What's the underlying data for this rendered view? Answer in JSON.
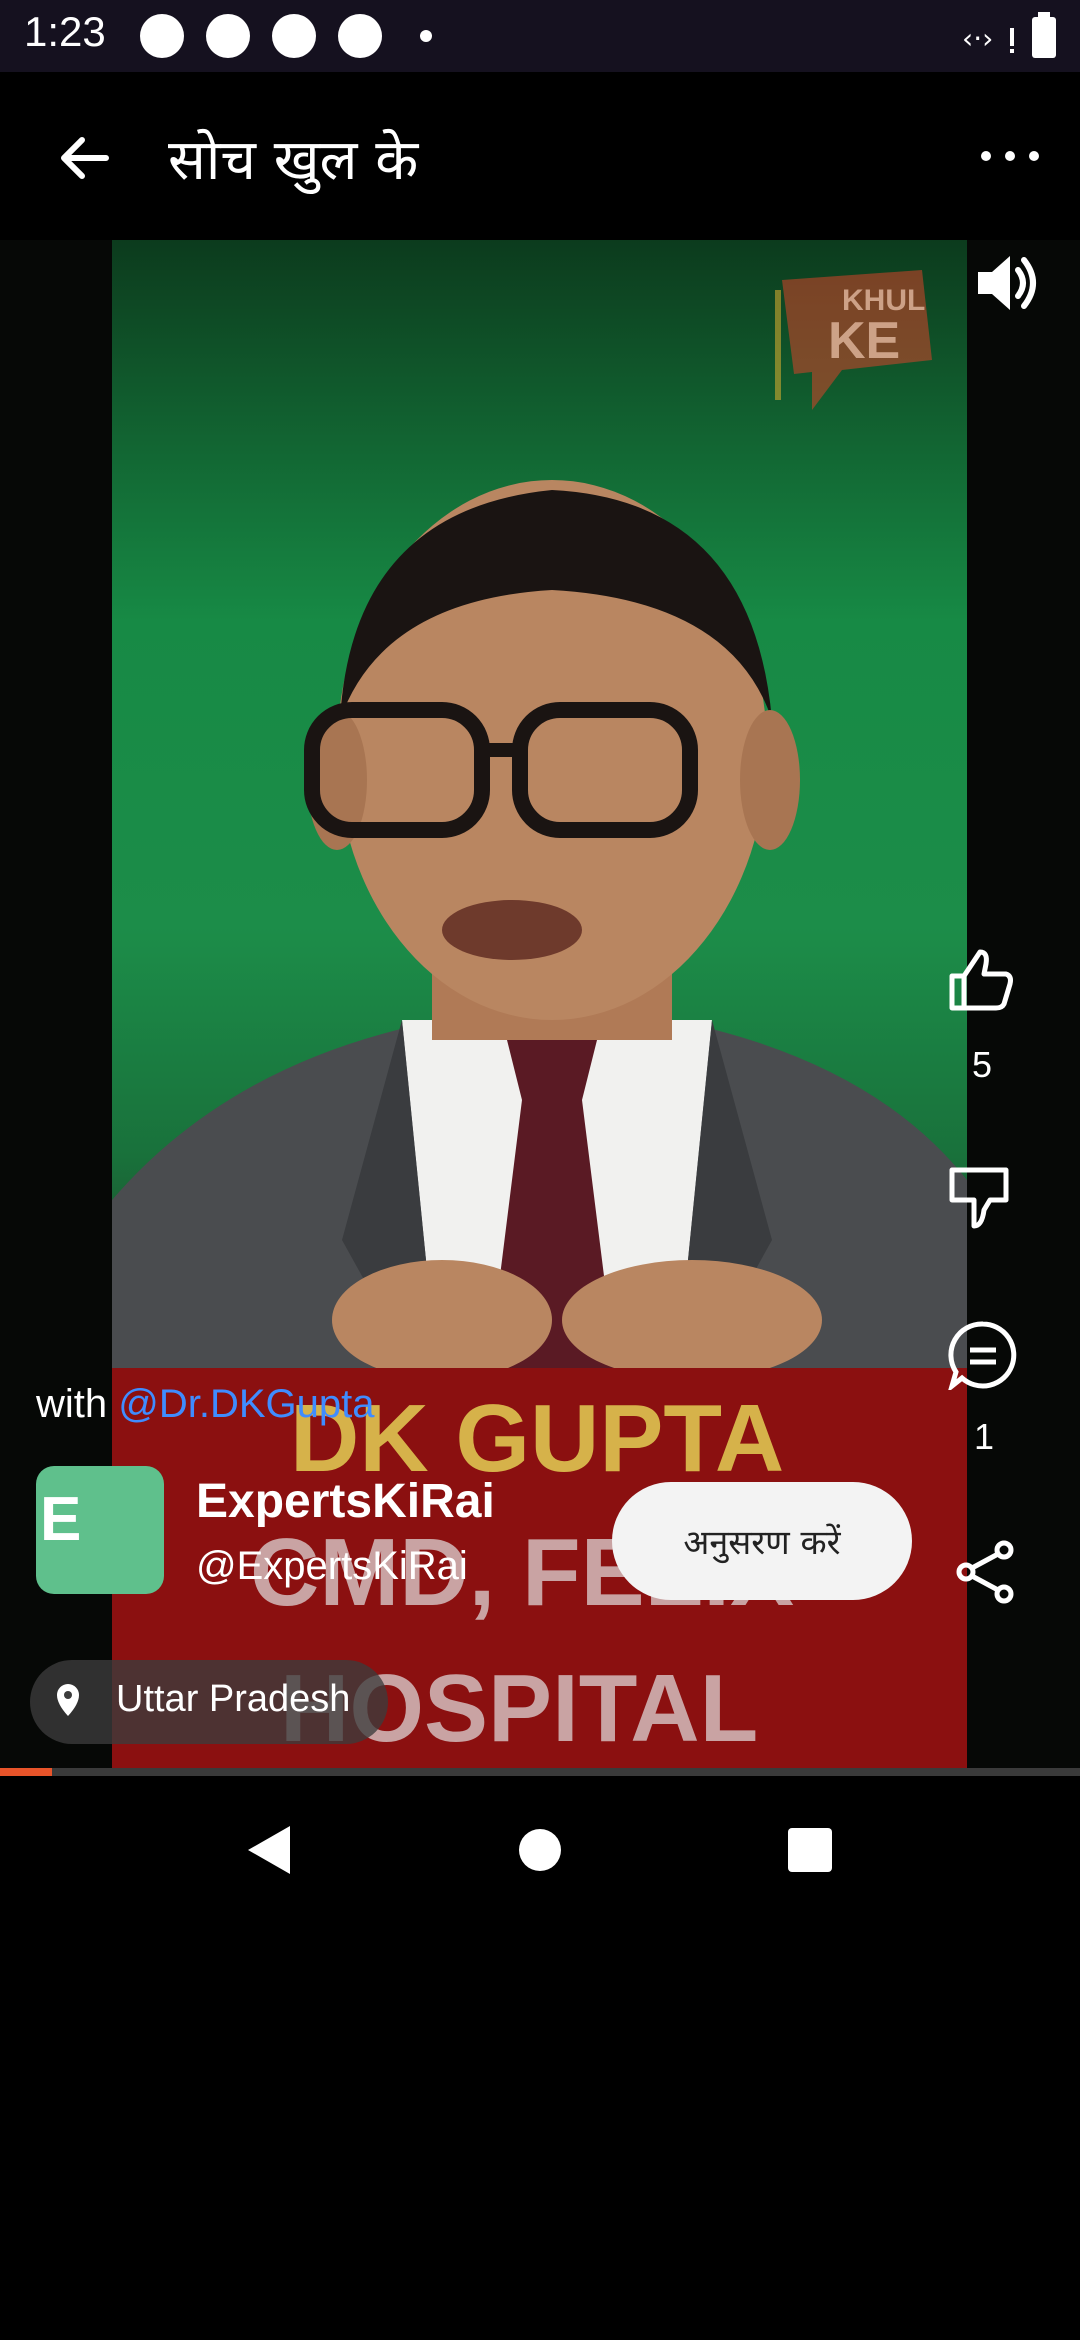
{
  "status_bar": {
    "time": "1:23"
  },
  "header": {
    "title": "सोच खुल के"
  },
  "video": {
    "watermark": [
      "KHUL",
      "KE"
    ],
    "banner_lines": [
      "DK GUPTA",
      "CMD, FELIX",
      "HOSPITAL"
    ]
  },
  "actions": {
    "like_count": "5",
    "comment_count": "1"
  },
  "post": {
    "with_prefix": "with",
    "mention": "@Dr.DKGupta",
    "avatar_letter": "E",
    "author_name": "ExpertsKiRai",
    "author_handle": "@ExpertsKiRai",
    "follow_label": "अनुसरण करें",
    "location": "Uttar Pradesh"
  },
  "progress": {
    "value": 0.048
  },
  "colors": {
    "accent": "#e8542a",
    "mention": "#3f8cff",
    "avatar": "#5fc08c"
  }
}
